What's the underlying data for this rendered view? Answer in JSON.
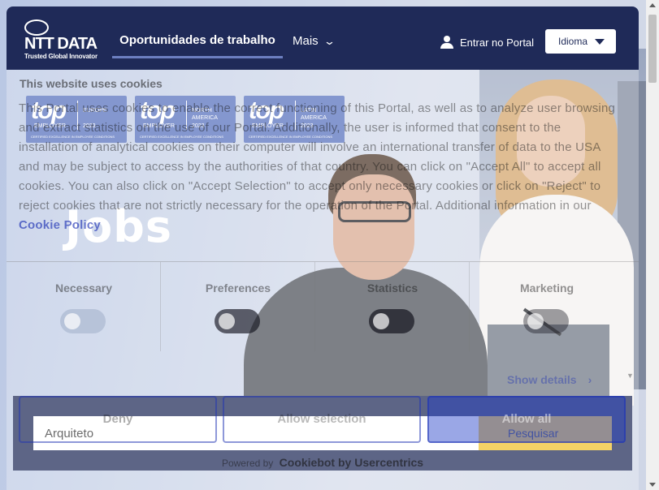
{
  "header": {
    "logo_word": "NTT DATA",
    "logo_tagline": "Trusted Global Innovator",
    "nav_jobs": "Oportunidades de trabalho",
    "nav_more": "Mais",
    "login": "Entrar no Portal",
    "language": "Idioma"
  },
  "badges": [
    {
      "top": "top",
      "employer": "EMPLOYER",
      "region": "EUROPE",
      "year": "2023",
      "cert": "CERTIFIED EXCELLENCE IN EMPLOYEE CONDITIONS"
    },
    {
      "top": "top",
      "employer": "EMPLOYER",
      "region": "NORTH\nAMERICA",
      "year": "2023",
      "cert": "CERTIFIED EXCELLENCE IN EMPLOYEE CONDITIONS"
    },
    {
      "top": "top",
      "employer": "EMPLOYER",
      "region": "LATIN\nAMERICA",
      "year": "2023",
      "cert": "CERTIFIED EXCELLENCE IN EMPLOYEE CONDITIONS"
    }
  ],
  "hero": {
    "title": "Jobs"
  },
  "search": {
    "value": "Arquiteto",
    "button": "Pesquisar"
  },
  "cookie": {
    "title": "This website uses cookies",
    "body_text": "This Portal uses cookies to enable the correct functioning of this Portal, as well as to analyze user browsing and extract statistics on the use of our Portal. Additionally, the user is informed that consent to the installation of analytical cookies on their computer will involve an international transfer of data to the USA and may be subject to access by the authorities of that country. You can click on \"Accept All\" to accept all cookies. You can also click on \"Accept Selection\" to accept only necessary cookies or click on \"Reject\" to reject cookies that are not strictly necessary for the operation of the Portal. Additional information in our",
    "policy_link": "Cookie Policy",
    "categories": [
      "Necessary",
      "Preferences",
      "Statistics",
      "Marketing"
    ],
    "show_details": "Show details",
    "deny": "Deny",
    "allow_selection": "Allow selection",
    "allow_all": "Allow all",
    "powered_by": "Powered by",
    "powered_brand": "Cookiebot by Usercentrics"
  },
  "icons": {
    "user": "user-icon",
    "caret": "caret-down-icon",
    "chevron": "chevron-down-icon"
  },
  "colors": {
    "brand_navy": "#1f2a58",
    "badge_blue": "#5570bd",
    "search_yellow": "#f0c12b",
    "cookie_link": "#1e32b4"
  }
}
